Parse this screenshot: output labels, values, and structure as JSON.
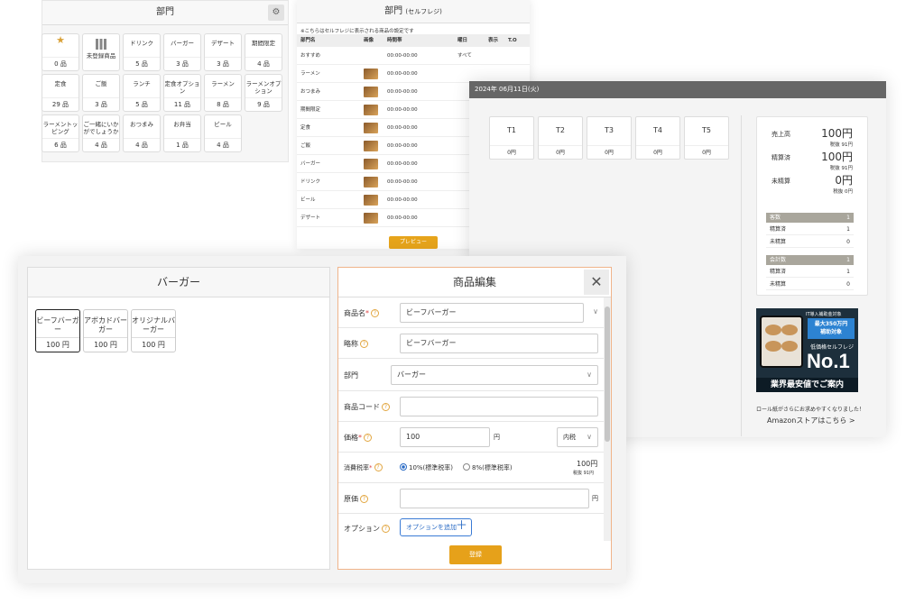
{
  "dept_panel": {
    "title": "部門",
    "tiles": [
      {
        "name": "★",
        "count": "0 品"
      },
      {
        "name": "未登録商品",
        "count": ""
      },
      {
        "name": "ドリンク",
        "count": "5 品"
      },
      {
        "name": "バーガー",
        "count": "3 品"
      },
      {
        "name": "デザート",
        "count": "3 品"
      },
      {
        "name": "期間限定",
        "count": "4 品"
      },
      {
        "name": "定食",
        "count": "29 品"
      },
      {
        "name": "ご飯",
        "count": "3 品"
      },
      {
        "name": "ランチ",
        "count": "5 品"
      },
      {
        "name": "定食オプション",
        "count": "11 品"
      },
      {
        "name": "ラーメン",
        "count": "8 品"
      },
      {
        "name": "ラーメンオプション",
        "count": "9 品"
      },
      {
        "name": "ラーメントッピング",
        "count": "6 品"
      },
      {
        "name": "ご一緒にいかがでしょうか",
        "count": "4 品"
      },
      {
        "name": "おつまみ",
        "count": "4 品"
      },
      {
        "name": "お弁当",
        "count": "1 品"
      },
      {
        "name": "ビール",
        "count": "4 品"
      }
    ]
  },
  "self_panel": {
    "title": "部門",
    "title_sub": "(セルフレジ)",
    "note": "※こちらはセルフレジに表示される商品の設定です",
    "headers": [
      "部門名",
      "画像",
      "時間帯",
      "曜日",
      "表示",
      "T.O"
    ],
    "rows": [
      {
        "name": "おすすめ",
        "img": false,
        "time": "00:00-00:00",
        "day": "すべて"
      },
      {
        "name": "ラーメン",
        "img": true,
        "time": "00:00-00:00",
        "day": ""
      },
      {
        "name": "おつまみ",
        "img": true,
        "time": "00:00-00:00",
        "day": ""
      },
      {
        "name": "期間限定",
        "img": true,
        "time": "00:00-00:00",
        "day": ""
      },
      {
        "name": "定食",
        "img": true,
        "time": "00:00-00:00",
        "day": ""
      },
      {
        "name": "ご飯",
        "img": true,
        "time": "00:00-00:00",
        "day": ""
      },
      {
        "name": "バーガー",
        "img": true,
        "time": "00:00-00:00",
        "day": ""
      },
      {
        "name": "ドリンク",
        "img": true,
        "time": "00:00-00:00",
        "day": ""
      },
      {
        "name": "ビール",
        "img": true,
        "time": "00:00-00:00",
        "day": ""
      },
      {
        "name": "デザート",
        "img": true,
        "time": "00:00-00:00",
        "day": ""
      }
    ],
    "preview_label": "プレビュー"
  },
  "tables_panel": {
    "date": "2024年 06月11日(火)",
    "tables": [
      {
        "label": "T1",
        "amount": "0円"
      },
      {
        "label": "T2",
        "amount": "0円"
      },
      {
        "label": "T3",
        "amount": "0円"
      },
      {
        "label": "T4",
        "amount": "0円"
      },
      {
        "label": "T5",
        "amount": "0円"
      }
    ],
    "summary": {
      "sales_label": "売上高",
      "sales": "100円",
      "sales_tax": "税抜 91円",
      "settled_label": "精算済",
      "settled": "100円",
      "settled_tax": "税抜 91円",
      "unsettled_label": "未精算",
      "unsettled": "0円",
      "unsettled_tax": "税抜 0円",
      "guests_label": "客数",
      "guests": "1",
      "g_settled_label": "精算済",
      "g_settled": "1",
      "g_unsettled_label": "未精算",
      "g_unsettled": "0",
      "checks_label": "会計数",
      "checks": "1",
      "c_settled_label": "精算済",
      "c_settled": "1",
      "c_unsettled_label": "未精算",
      "c_unsettled": "0"
    },
    "ad": {
      "tag": "IT導入補助金対象",
      "blue": "最大350万円\n補助対象",
      "small": "低価格セルフレジ",
      "big": "No.1",
      "bottom": "業界最安値でご案内"
    },
    "ad_note": "ロール紙がさらにお求めやすくなりました！",
    "amazon_link": "Amazonストアはこちら >"
  },
  "product_panel": {
    "category_title": "バーガー",
    "products": [
      {
        "name": "ビーフバーガー",
        "price": "100 円"
      },
      {
        "name": "アボカドバーガー",
        "price": "100 円"
      },
      {
        "name": "オリジナルバーガー",
        "price": "100 円"
      }
    ],
    "editor": {
      "title": "商品編集",
      "close": "✕",
      "name_label": "商品名",
      "name_value": "ビーフバーガー",
      "short_label": "略称",
      "short_value": "ビーフバーガー",
      "dept_label": "部門",
      "dept_value": "バーガー",
      "code_label": "商品コード",
      "code_value": "",
      "price_label": "価格",
      "price_value": "100",
      "price_unit": "円",
      "tax_mode": "内税",
      "taxrate_label": "消費税率",
      "rate10": "10%(標準税率)",
      "rate8": "8%(標準税率)",
      "tax_price": "100円",
      "tax_note": "税抜 91円",
      "cost_label": "原価",
      "cost_value": "",
      "cost_unit": "円",
      "option_label": "オプション",
      "option_button": "オプションを追加",
      "register": "登録"
    }
  },
  "icons": {
    "question": "?",
    "plus": "＋",
    "chevron": "∨",
    "gear": "⚙"
  }
}
